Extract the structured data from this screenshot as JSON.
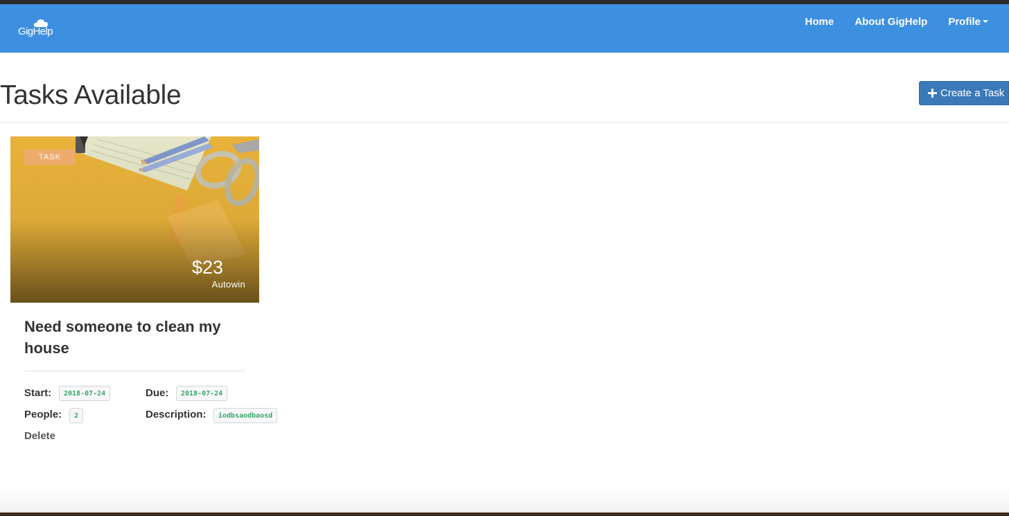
{
  "navbar": {
    "brand": "GigHelp",
    "links": [
      "Home",
      "About GigHelp",
      "Profile"
    ],
    "brand_color": "#3d8fe0"
  },
  "page": {
    "title": "Tasks Available",
    "create_button_label": "Create a Task"
  },
  "task_card": {
    "tag": "TASK",
    "price": "$23",
    "poster": "Autowin",
    "title": "Need someone to clean my house",
    "start_label": "Start:",
    "start_value": "2018-07-24",
    "due_label": "Due:",
    "due_value": "2018-07-24",
    "people_label": "People:",
    "people_value": "2",
    "description_label": "Description:",
    "description_value": "iodbsaodbaosd",
    "delete_label": "Delete"
  }
}
